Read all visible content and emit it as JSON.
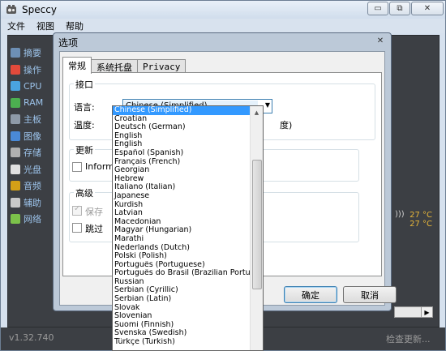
{
  "window": {
    "title": "Speccy",
    "buttons": {
      "minimize": "▭",
      "restore": "⧉",
      "close": "✕"
    }
  },
  "menu": {
    "items": [
      "文件",
      "视图",
      "帮助"
    ]
  },
  "sidebar": {
    "items": [
      {
        "label": "摘要",
        "icon": "summary-icon",
        "color": "#6d8fb5"
      },
      {
        "label": "操作",
        "icon": "windows-logo-icon",
        "color": "#e24a3b"
      },
      {
        "label": "CPU",
        "icon": "cpu-icon",
        "color": "#4aa3df"
      },
      {
        "label": "RAM",
        "icon": "ram-icon",
        "color": "#4caf50"
      },
      {
        "label": "主板",
        "icon": "motherboard-icon",
        "color": "#8e9aa8"
      },
      {
        "label": "图像",
        "icon": "monitor-icon",
        "color": "#4a89d6"
      },
      {
        "label": "存储",
        "icon": "hard-drive-icon",
        "color": "#b0b0b0"
      },
      {
        "label": "光盘",
        "icon": "optical-disc-icon",
        "color": "#e0e0e0"
      },
      {
        "label": "音频",
        "icon": "speaker-icon",
        "color": "#d4a017"
      },
      {
        "label": "辅助",
        "icon": "mouse-icon",
        "color": "#c9c9c9"
      },
      {
        "label": "网络",
        "icon": "network-icon",
        "color": "#7cc24a"
      }
    ]
  },
  "temps": [
    "27 °C",
    "27 °C"
  ],
  "status": {
    "version": "v1.32.740",
    "check_update": "检查更新..."
  },
  "dialog": {
    "title": "选项",
    "close": "✕",
    "tabs": [
      {
        "label": "常规",
        "active": true
      },
      {
        "label": "系统托盘",
        "active": false
      },
      {
        "label": "Privacy",
        "active": false
      }
    ],
    "interface": {
      "label": "接口",
      "language_label": "语言:",
      "language_value": "Chinese (Simplified)",
      "temperature_label": "温度:",
      "temperature_tail": "度)"
    },
    "update": {
      "label": "更新",
      "inform_checkbox": "Inform"
    },
    "advanced": {
      "label": "高级",
      "save_checkbox": "保存",
      "skip_checkbox": "跳过"
    },
    "buttons": {
      "ok": "确定",
      "cancel": "取消"
    }
  },
  "language_list": {
    "selected": "Chinese (Simplified)",
    "items": [
      "Chinese (Simplified)",
      "Croatian",
      "Deutsch (German)",
      "English",
      "English",
      "Español (Spanish)",
      "Français (French)",
      "Georgian",
      "Hebrew",
      "Italiano (Italian)",
      "Japanese",
      "Kurdish",
      "Latvian",
      "Macedonian",
      "Magyar (Hungarian)",
      "Marathi",
      "Nederlands (Dutch)",
      "Polski (Polish)",
      "Português (Portuguese)",
      "Português do Brasil (Brazilian Portuguese)",
      "Russian",
      "Serbian (Cyrillic)",
      "Serbian (Latin)",
      "Slovak",
      "Slovenian",
      "Suomi (Finnish)",
      "Svenska (Swedish)",
      "Türkçe (Turkish)"
    ]
  }
}
